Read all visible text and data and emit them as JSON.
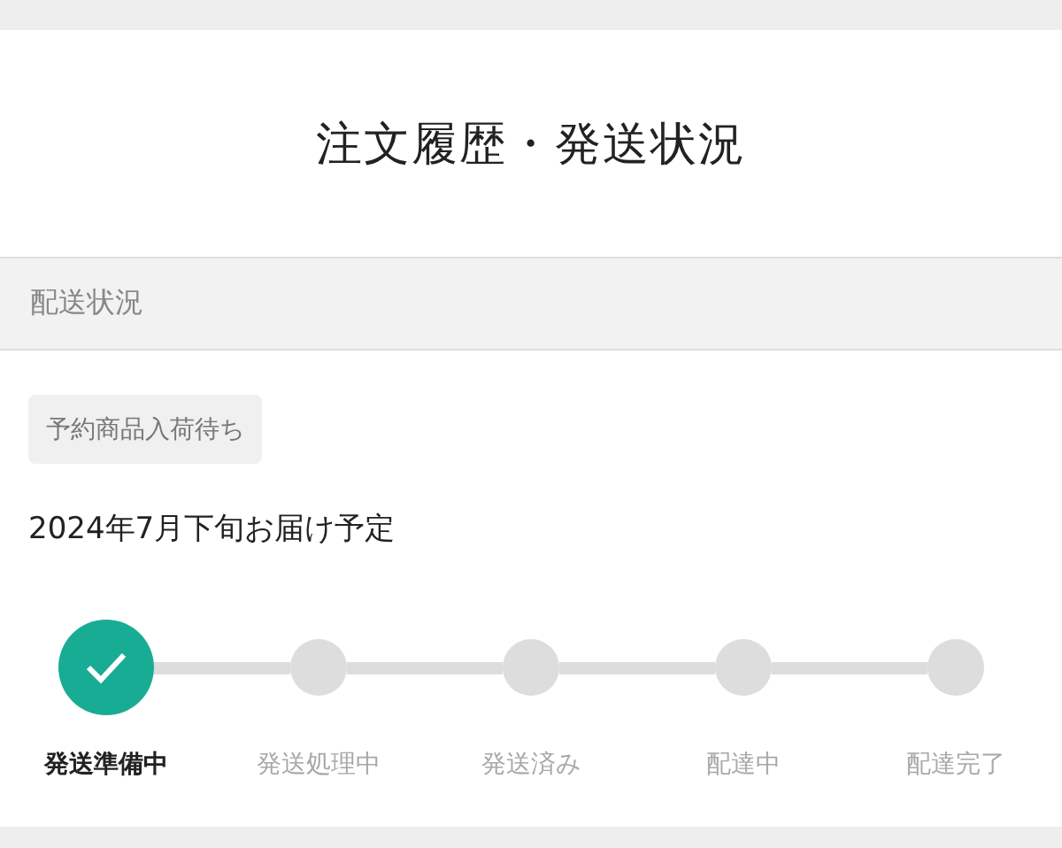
{
  "header": {
    "title": "注文履歴・発送状況"
  },
  "section": {
    "title": "配送状況"
  },
  "status_tag": "予約商品入荷待ち",
  "delivery_estimate": "2024年7月下旬お届け予定",
  "steps": [
    {
      "label": "発送準備中",
      "completed": true
    },
    {
      "label": "発送処理中",
      "completed": false
    },
    {
      "label": "発送済み",
      "completed": false
    },
    {
      "label": "配達中",
      "completed": false
    },
    {
      "label": "配達完了",
      "completed": false
    }
  ]
}
